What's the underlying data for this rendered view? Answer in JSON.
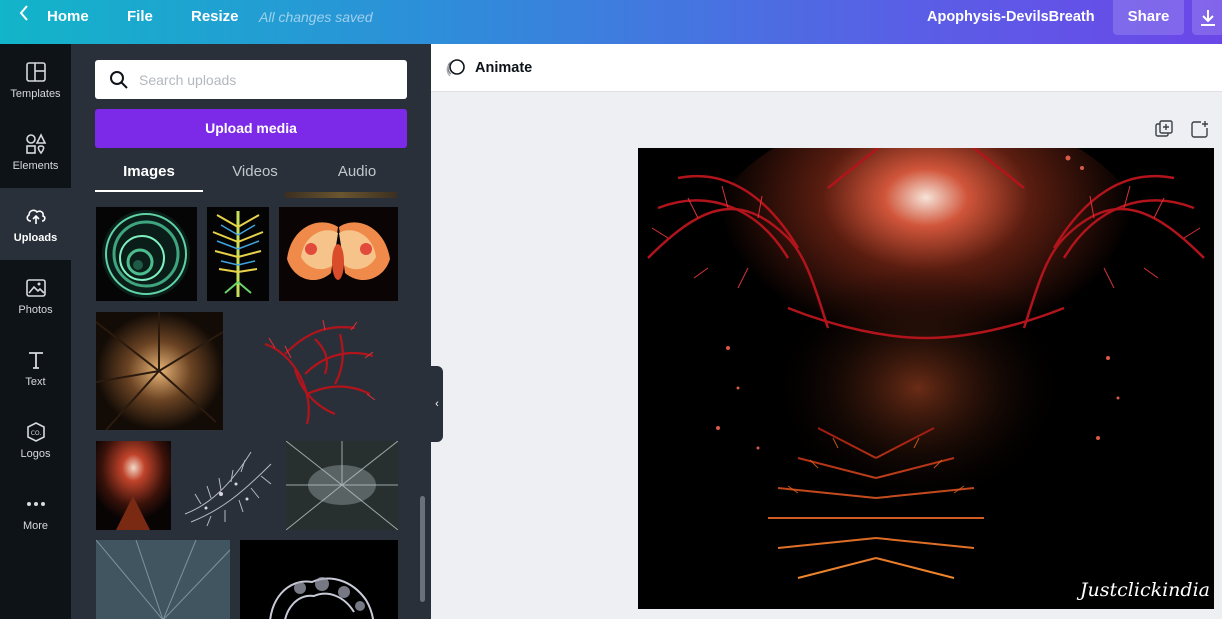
{
  "topbar": {
    "home_label": "Home",
    "file_label": "File",
    "resize_label": "Resize",
    "save_status": "All changes saved",
    "design_title": "Apophysis-DevilsBreath",
    "share_label": "Share"
  },
  "rail": {
    "items": [
      {
        "label": "Templates",
        "icon": "templates-icon"
      },
      {
        "label": "Elements",
        "icon": "elements-icon"
      },
      {
        "label": "Uploads",
        "icon": "uploads-icon",
        "active": true
      },
      {
        "label": "Photos",
        "icon": "photos-icon"
      },
      {
        "label": "Text",
        "icon": "text-icon"
      },
      {
        "label": "Logos",
        "icon": "logos-icon"
      },
      {
        "label": "More",
        "icon": "more-icon"
      }
    ]
  },
  "panel": {
    "search_placeholder": "Search uploads",
    "upload_button": "Upload media",
    "tabs": [
      {
        "label": "Images",
        "active": true
      },
      {
        "label": "Videos"
      },
      {
        "label": "Audio"
      }
    ]
  },
  "editor": {
    "animate_label": "Animate",
    "signature": "Justclickindia"
  },
  "colors": {
    "accent": "#7d2ae8",
    "panel_bg": "#293039",
    "rail_bg": "#0e1318"
  }
}
